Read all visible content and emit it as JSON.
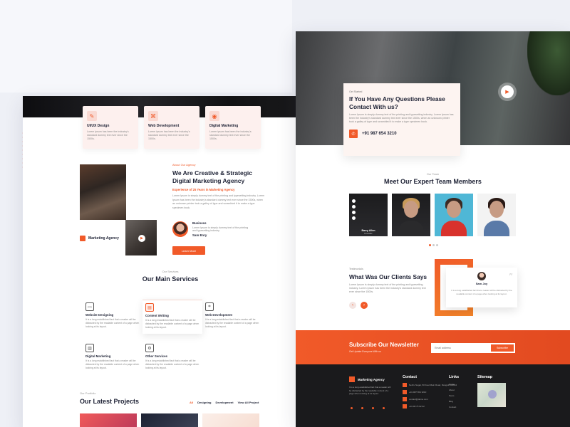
{
  "left": {
    "service_cards": [
      {
        "title": "UI/UX Design",
        "desc": "Lorem ipsum has been the industry's standard dummy text ever since the 1500s."
      },
      {
        "title": "Web Development",
        "desc": "Lorem ipsum has been the industry's standard dummy text ever since the 1500s."
      },
      {
        "title": "Digital Marketing",
        "desc": "Lorem ipsum has been the industry's standard dummy text ever since the 1500s."
      }
    ],
    "about": {
      "kicker": "About Our Agency",
      "title": "We Are Creative & Strategic Digital Marketing Agency",
      "subtitle": "Experience of 25 Years in Marketing Agency",
      "body": "Lorem Ipsum is simply dummy text of the printing and typesetting industry. Lorem Ipsum has been the industry's standard dummy text ever since the 1500s, when an unknown printer took a galley of type and scrambled it to make a type specimen book.",
      "badge": "Marketing Agency",
      "business_title": "Business",
      "business_desc": "Lorem Ipsum is simply dummy text of the printing and typesetting industry.",
      "signature": "Sam Enry",
      "button": "Learn More"
    },
    "services": {
      "kicker": "Our Services",
      "title": "Our Main Services",
      "items": [
        {
          "title": "Website Designing",
          "desc": "It is a long established fact that a reader will be distracted by the readable content of a page when looking at its layout."
        },
        {
          "title": "Content Writing",
          "desc": "It is a long established fact that a reader will be distracted by the readable content of a page when looking at its layout."
        },
        {
          "title": "Web Development",
          "desc": "It is a long established fact that a reader will be distracted by the readable content of a page when looking at its layout."
        },
        {
          "title": "Digital Marketing",
          "desc": "It is a long established fact that a reader will be distracted by the readable content of a page when looking at its layout."
        },
        {
          "title": "Other Services",
          "desc": "It is a long established fact that a reader will be distracted by the readable content of a page when looking at its layout."
        }
      ]
    },
    "portfolio": {
      "kicker": "Our Portfolio",
      "title": "Our Latest Projects",
      "filters": [
        "All",
        "Designing",
        "Development",
        "View All Project"
      ]
    }
  },
  "right": {
    "contact": {
      "kicker": "Get Started",
      "title": "If You Have Any Questions Please Contact With us?",
      "body": "Lorem Ipsum is simply dummy text of the printing and typesetting industry. Lorem Ipsum has been the industry's standard dummy text ever since the 1500s, when an unknown printer took a galley of type and scrambled it to make a type specimen book.",
      "phone": "+91 987 654 3210"
    },
    "team": {
      "kicker": "Our Team",
      "title": "Meet Our Expert Team Members",
      "featured_name": "Barry Allen",
      "featured_role": "Founder"
    },
    "clients": {
      "kicker": "Testimonials",
      "title": "What Was Our Clients Says",
      "body": "Lorem Ipsum is simply dummy text of the printing and typesetting industry. Lorem Ipsum has been the industry's standard dummy text ever since the 1500s.",
      "reviewer": "Sam Joy",
      "quote": "It is a long established fact that a reader will be distracted by the readable content of a page when looking at its layout."
    },
    "newsletter": {
      "title": "Subscribe Our Newsletter",
      "sub": "Get Update Everyone With us",
      "placeholder": "Email address",
      "button": "Subscribe"
    },
    "footer": {
      "brand": "Marketing Agency",
      "desc": "It is a long established fact that a reader will be distracted by the readable content of a page when looking at its layout.",
      "contact_title": "Contact",
      "contact_lines": [
        "Nehru Nagar, 80 Feet Main Road, Rangoli-600044",
        "+91 987 654 3210",
        "contact@demo.com",
        "+91 98 75 02 02"
      ],
      "links_title": "Links",
      "links": [
        "Home",
        "About",
        "Team",
        "Blog",
        "Contact"
      ],
      "sitemap_title": "Sitemap"
    }
  }
}
